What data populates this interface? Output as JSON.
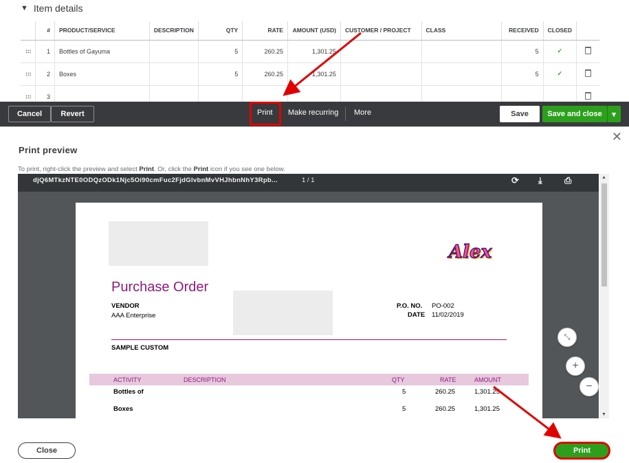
{
  "item_details": {
    "heading": "Item details",
    "columns": [
      "#",
      "PRODUCT/SERVICE",
      "DESCRIPTION",
      "QTY",
      "RATE",
      "AMOUNT (USD)",
      "CUSTOMER / PROJECT",
      "CLASS",
      "RECEIVED",
      "CLOSED"
    ],
    "rows": [
      {
        "num": "1",
        "product": "Bottles of Gayuma",
        "description": "",
        "qty": "5",
        "rate": "260.25",
        "amount": "1,301.25",
        "customer": "",
        "class": "",
        "received": "5",
        "closed": "✓"
      },
      {
        "num": "2",
        "product": "Boxes",
        "description": "",
        "qty": "5",
        "rate": "260.25",
        "amount": "1,301.25",
        "customer": "",
        "class": "",
        "received": "5",
        "closed": "✓"
      },
      {
        "num": "3",
        "product": "",
        "description": "",
        "qty": "",
        "rate": "",
        "amount": "",
        "customer": "",
        "class": "",
        "received": "",
        "closed": ""
      }
    ]
  },
  "toolbar": {
    "cancel": "Cancel",
    "revert": "Revert",
    "print": "Print",
    "make_recurring": "Make recurring",
    "more": "More",
    "save": "Save",
    "save_and_close": "Save and close"
  },
  "modal": {
    "title": "Print preview",
    "hint_pre": "To print, right-click the preview and select ",
    "hint_b1": "Print",
    "hint_mid": ". Or, click the ",
    "hint_b2": "Print",
    "hint_post": " icon if you see one below.",
    "close_label": "Close",
    "print_label": "Print"
  },
  "viewer": {
    "filename": "djQ6MTkzNTE0ODQzODk1Njc5Oi90cmFuc2FjdGlvbnMvVHJhbnNhY3Rpb...",
    "page_indicator": "1  /  1"
  },
  "document": {
    "title": "Purchase Order",
    "brand": "Alex",
    "vendor_label": "VENDOR",
    "vendor_name": "AAA Enterprise",
    "po_no_label": "P.O. NO.",
    "po_no_value": "PO-002",
    "date_label": "DATE",
    "date_value": "11/02/2019",
    "ship_to": "SAMPLE CUSTOM",
    "table_headers": {
      "activity": "ACTIVITY",
      "description": "DESCRIPTION",
      "qty": "QTY",
      "rate": "RATE",
      "amount": "AMOUNT"
    },
    "lines": [
      {
        "activity": "Bottles of",
        "qty": "5",
        "rate": "260.25",
        "amount": "1,301.25"
      },
      {
        "activity": "Boxes",
        "qty": "5",
        "rate": "260.25",
        "amount": "1,301.25"
      }
    ]
  },
  "colors": {
    "brand_green": "#2ca01c",
    "annotation_red": "#e00000",
    "po_purple": "#8e1a7d",
    "toolbar_dark": "#393a3d"
  }
}
